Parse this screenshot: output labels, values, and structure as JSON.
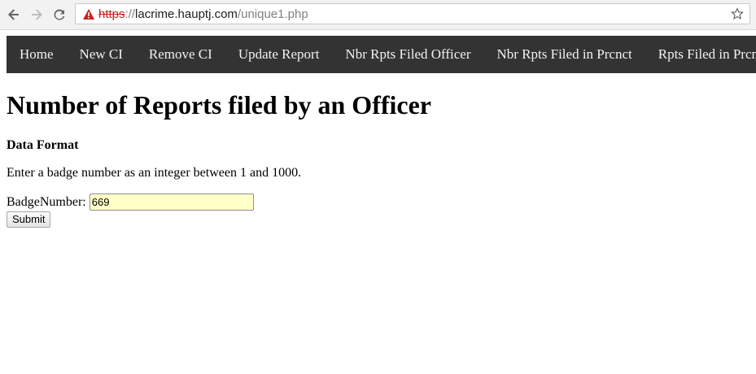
{
  "browser": {
    "url_scheme": "https",
    "url_separator": "://",
    "url_host": "lacrime.hauptj.com",
    "url_path": "/unique1.php",
    "icons": [
      "back-arrow-icon",
      "forward-arrow-icon",
      "reload-icon",
      "not-secure-warning-icon",
      "bookmark-star-icon"
    ]
  },
  "nav": {
    "items": [
      {
        "label": "Home"
      },
      {
        "label": "New CI"
      },
      {
        "label": "Remove CI"
      },
      {
        "label": "Update Report"
      },
      {
        "label": "Nbr Rpts Filed Officer"
      },
      {
        "label": "Nbr Rpts Filed in Prcnct"
      },
      {
        "label": "Rpts Filed in Prcnct"
      }
    ],
    "background": "#333333",
    "text_color": "#f2f2f2"
  },
  "page": {
    "title": "Number of Reports filed by an Officer",
    "data_format_heading": "Data Format",
    "data_format_text": "Enter a badge number as an integer between 1 and 1000."
  },
  "form": {
    "badge_label": "BadgeNumber:",
    "badge_value": "669",
    "input_background": "#ffffc8",
    "submit_label": "Submit"
  }
}
